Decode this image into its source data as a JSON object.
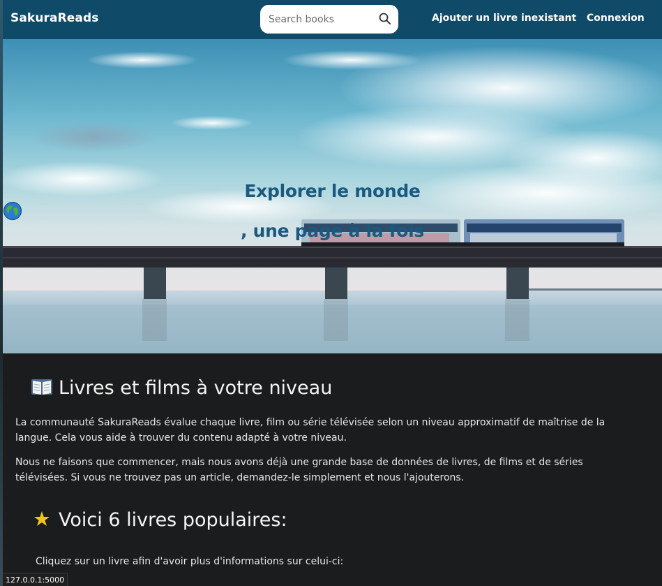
{
  "navbar": {
    "brand": "SakuraReads",
    "search_placeholder": "Search books",
    "search_icon": "search-icon",
    "links": {
      "add_book": "Ajouter un livre inexistant",
      "login": "Connexion"
    },
    "background_color": "#0f4a69"
  },
  "hero": {
    "title_before": "Explorer le monde ",
    "title_after": ", une page à la fois",
    "title_icon": "globe-icon",
    "title_color": "#1a5a80"
  },
  "sections": {
    "levels": {
      "icon": "open-book-icon",
      "heading": "Livres et films à votre niveau",
      "paragraph_1": "La communauté SakuraReads évalue chaque livre, film ou série télévisée selon un niveau approximatif de maîtrise de la langue. Cela vous aide à trouver du contenu adapté à votre niveau.",
      "paragraph_2": "Nous ne faisons que commencer, mais nous avons déjà une grande base de données de livres, de films et de séries télévisées. Si vous ne trouvez pas un article, demandez-le simplement et nous l'ajouterons."
    },
    "popular": {
      "icon": "star-icon",
      "heading": "Voici 6 livres populaires:",
      "hint": "Cliquez sur un livre afin d'avoir plus d'informations sur celui-ci:"
    }
  },
  "status_bar": {
    "url": "127.0.0.1:5000"
  }
}
